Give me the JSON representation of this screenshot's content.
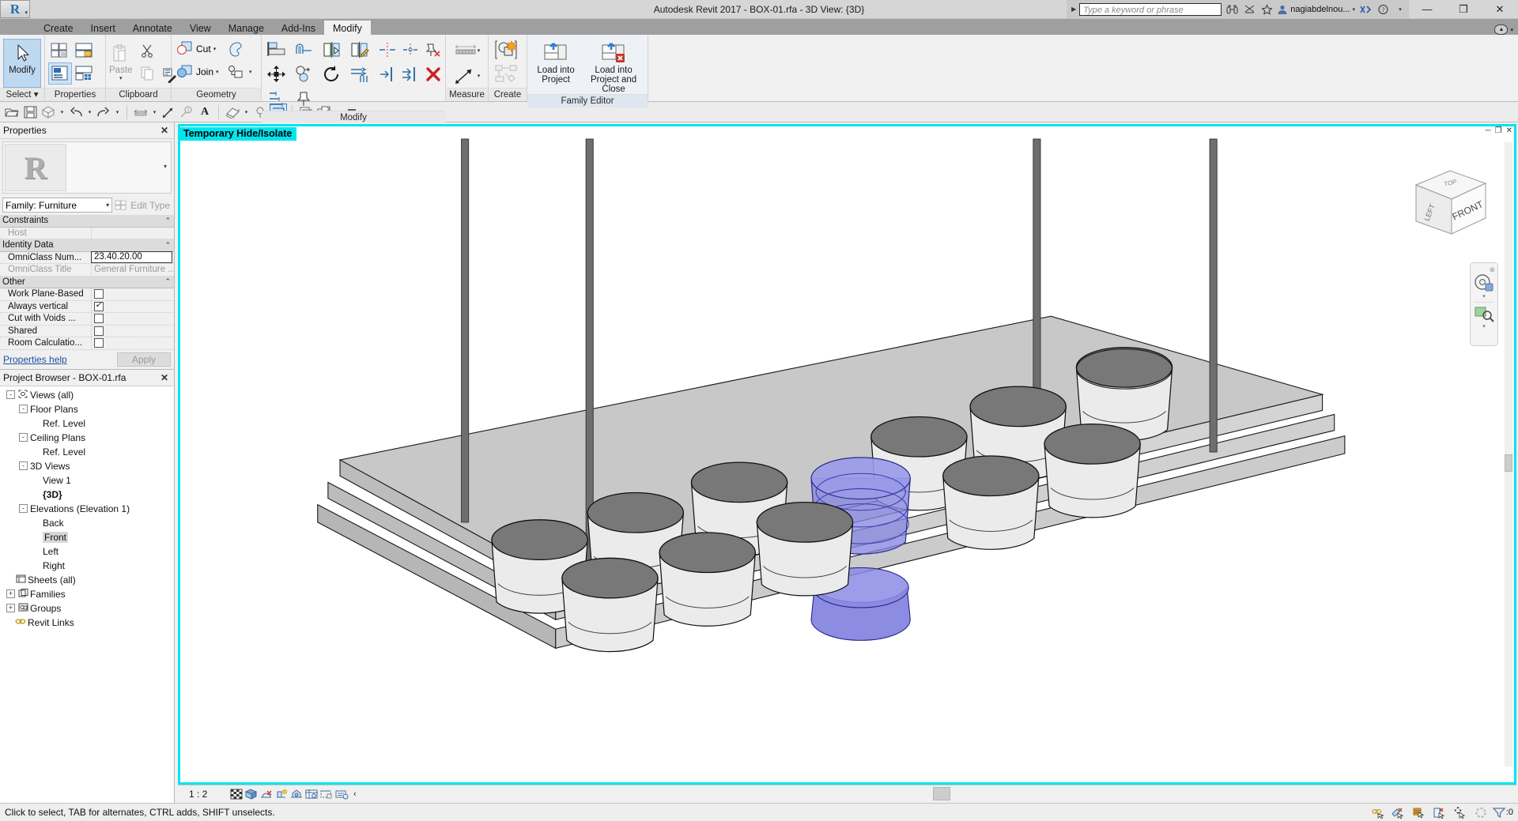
{
  "window": {
    "title": "Autodesk Revit 2017 -    BOX-01.rfa - 3D View: {3D}",
    "minimize": "—",
    "maximize": "❐",
    "close": "✕"
  },
  "titlebar": {
    "search_placeholder": "Type a keyword or phrase",
    "search_arrow": "▶",
    "user_name": "nagiabdelnou...",
    "user_caret": "▾",
    "help_caret": "▾",
    "icons": [
      "binoculars-icon",
      "subscription-icon",
      "favorites-star-icon",
      "user-avatar-icon",
      "exchange-app-icon",
      "help-icon"
    ]
  },
  "ribbon": {
    "tabs": [
      {
        "label": "Create",
        "active": false
      },
      {
        "label": "Insert",
        "active": false
      },
      {
        "label": "Annotate",
        "active": false
      },
      {
        "label": "View",
        "active": false
      },
      {
        "label": "Manage",
        "active": false
      },
      {
        "label": "Add-Ins",
        "active": false
      },
      {
        "label": "Modify",
        "active": true
      }
    ],
    "minimize_caret": "▾",
    "panels": [
      {
        "name": "Select",
        "label": "Select ▾",
        "buttons": [
          {
            "label": "Modify",
            "selected": true
          }
        ]
      },
      {
        "name": "Properties",
        "label": "Properties",
        "buttons": [
          {
            "label": "",
            "icon": "type-properties-icon"
          },
          {
            "label": "",
            "icon": "family-category-icon"
          },
          {
            "label": "",
            "icon": "family-types-icon",
            "selected": true
          },
          {
            "label": "",
            "icon": "family-parameters-icon"
          }
        ]
      },
      {
        "name": "Clipboard",
        "label": "Clipboard",
        "paste_label": "Paste",
        "paste_caret": "▾",
        "buttons": [
          {
            "label": "",
            "icon": "cut-icon"
          },
          {
            "label": "",
            "icon": "copy-icon"
          },
          {
            "label": "",
            "icon": "match-type-icon"
          }
        ]
      },
      {
        "name": "Geometry",
        "label": "Geometry",
        "buttons": [
          {
            "label": "Cut",
            "icon": "cut-geometry-icon",
            "caret": "▾"
          },
          {
            "label": "Join",
            "icon": "join-geometry-icon",
            "caret": "▾"
          },
          {
            "label": "",
            "icon": "paint-icon"
          },
          {
            "label": "",
            "icon": "split-face-icon",
            "caret": "▾"
          }
        ]
      },
      {
        "name": "Modify",
        "label": "Modify",
        "buttons": [
          {
            "label": "",
            "icon": "align-icon"
          },
          {
            "label": "",
            "icon": "offset-icon"
          },
          {
            "label": "",
            "icon": "mirror-pick-axis-icon"
          },
          {
            "label": "",
            "icon": "mirror-draw-axis-icon"
          },
          {
            "label": "",
            "icon": "split-element-icon"
          },
          {
            "label": "",
            "icon": "trim-extend-icon"
          },
          {
            "label": "",
            "icon": "unpin-icon"
          },
          {
            "label": "",
            "icon": "move-icon"
          },
          {
            "label": "",
            "icon": "copy-move-icon"
          },
          {
            "label": "",
            "icon": "rotate-icon"
          },
          {
            "label": "",
            "icon": "array-icon"
          },
          {
            "label": "",
            "icon": "scale-icon"
          },
          {
            "label": "",
            "icon": "pin-icon"
          },
          {
            "label": "",
            "icon": "trim-single-icon"
          },
          {
            "label": "",
            "icon": "trim-multiple-icon"
          },
          {
            "label": "",
            "icon": "delete-icon"
          }
        ]
      },
      {
        "name": "Measure",
        "label": "Measure",
        "buttons": [
          {
            "label": "",
            "icon": "measure-between-references-icon",
            "caret": "▾"
          },
          {
            "label": "",
            "icon": "measure-along-element-icon",
            "caret": "▾"
          }
        ]
      },
      {
        "name": "Create",
        "label": "Create",
        "buttons": [
          {
            "label": "",
            "icon": "create-similar-icon"
          },
          {
            "label": "",
            "icon": "create-group-icon"
          }
        ]
      },
      {
        "name": "Family Editor",
        "label": "Family Editor",
        "buttons": [
          {
            "label": "Load into\nProject",
            "line1": "Load into",
            "line2": "Project",
            "icon": "load-into-project-icon"
          },
          {
            "label": "Load into\nProject and Close",
            "line1": "Load into",
            "line2": "Project and Close",
            "icon": "load-into-project-and-close-icon"
          }
        ]
      }
    ]
  },
  "quick_access": {
    "items": [
      {
        "name": "open-icon",
        "caret": false
      },
      {
        "name": "save-icon",
        "caret": false
      },
      {
        "name": "3d-view-icon",
        "caret": true
      },
      {
        "name": "undo-icon",
        "caret": true
      },
      {
        "name": "redo-icon",
        "caret": true
      },
      {
        "name": "aligned-dimension-icon",
        "caret": true
      },
      {
        "name": "measure-icon",
        "caret": false
      },
      {
        "name": "tag-icon",
        "caret": false
      },
      {
        "name": "text-icon",
        "caret": false
      },
      {
        "name": "default-3d-view-icon",
        "caret": true
      },
      {
        "name": "section-icon",
        "caret": false
      },
      {
        "name": "thin-lines-icon",
        "caret": false,
        "selected": true
      },
      {
        "name": "close-hidden-windows-icon",
        "caret": false
      },
      {
        "name": "switch-windows-icon",
        "caret": true
      },
      {
        "name": "customize-qat-icon",
        "caret": false
      }
    ]
  },
  "properties_palette": {
    "title": "Properties",
    "close": "✕",
    "preview_glyph": "R",
    "preview_caret": "▾",
    "family_selector": "Family: Furniture",
    "family_caret": "▾",
    "edit_type": "Edit Type",
    "rows": [
      {
        "type": "group",
        "name": "Constraints",
        "chev": "⌃"
      },
      {
        "type": "row",
        "name": "Host",
        "value": "",
        "name_dim": true,
        "value_kind": "text"
      },
      {
        "type": "group",
        "name": "Identity Data",
        "chev": "⌃"
      },
      {
        "type": "row",
        "name": "OmniClass Num...",
        "value": "23.40.20.00",
        "value_kind": "boxed"
      },
      {
        "type": "row",
        "name": "OmniClass Title",
        "value": "General Furniture ...",
        "name_dim": true,
        "value_dim": true,
        "value_kind": "text"
      },
      {
        "type": "group",
        "name": "Other",
        "chev": "⌃"
      },
      {
        "type": "row",
        "name": "Work Plane-Based",
        "value_kind": "checkbox",
        "checked": false
      },
      {
        "type": "row",
        "name": "Always vertical",
        "value_kind": "checkbox",
        "checked": true
      },
      {
        "type": "row",
        "name": "Cut with Voids ...",
        "value_kind": "checkbox",
        "checked": false
      },
      {
        "type": "row",
        "name": "Shared",
        "value_kind": "checkbox",
        "checked": false
      },
      {
        "type": "row",
        "name": "Room Calculatio...",
        "value_kind": "checkbox",
        "checked": false
      }
    ],
    "help_link": "Properties help",
    "apply_button": "Apply"
  },
  "project_browser": {
    "title": "Project Browser - BOX-01.rfa",
    "close": "✕",
    "nodes": [
      {
        "label": "Views (all)",
        "depth": 0,
        "toggle": "-",
        "icon": "views-icon"
      },
      {
        "label": "Floor Plans",
        "depth": 1,
        "toggle": "-",
        "icon": ""
      },
      {
        "label": "Ref. Level",
        "depth": 2,
        "toggle": "",
        "icon": ""
      },
      {
        "label": "Ceiling Plans",
        "depth": 1,
        "toggle": "-",
        "icon": ""
      },
      {
        "label": "Ref. Level",
        "depth": 2,
        "toggle": "",
        "icon": ""
      },
      {
        "label": "3D Views",
        "depth": 1,
        "toggle": "-",
        "icon": ""
      },
      {
        "label": "View 1",
        "depth": 2,
        "toggle": "",
        "icon": ""
      },
      {
        "label": "{3D}",
        "depth": 2,
        "toggle": "",
        "icon": "",
        "bold": true
      },
      {
        "label": "Elevations (Elevation 1)",
        "depth": 1,
        "toggle": "-",
        "icon": ""
      },
      {
        "label": "Back",
        "depth": 2,
        "toggle": "",
        "icon": ""
      },
      {
        "label": "Front",
        "depth": 2,
        "toggle": "",
        "icon": "",
        "highlight": true
      },
      {
        "label": "Left",
        "depth": 2,
        "toggle": "",
        "icon": ""
      },
      {
        "label": "Right",
        "depth": 2,
        "toggle": "",
        "icon": ""
      },
      {
        "label": "Sheets (all)",
        "depth": 0,
        "toggle": "",
        "icon": "sheets-icon"
      },
      {
        "label": "Families",
        "depth": 0,
        "toggle": "+",
        "icon": "families-icon"
      },
      {
        "label": "Groups",
        "depth": 0,
        "toggle": "+",
        "icon": "groups-icon"
      },
      {
        "label": "Revit Links",
        "depth": 0,
        "toggle": "",
        "icon": "revit-links-icon"
      }
    ]
  },
  "view": {
    "hide_isolate_banner": "Temporary Hide/Isolate",
    "window_controls": {
      "minimize": "─",
      "restore": "❐",
      "close": "✕"
    },
    "viewcube": {
      "front": "FRONT",
      "left": "LEFT",
      "top": "TOP"
    },
    "nav_bar": {
      "close": "⊗",
      "steering_wheel": "steering-wheel-icon",
      "zoom": "zoom-icon",
      "caret": "▾"
    }
  },
  "view_control_bar": {
    "scale": "1 : 2",
    "icons": [
      "detail-level-icon",
      "visual-style-icon",
      "sun-path-icon",
      "shadows-icon",
      "render-icon",
      "crop-view-icon",
      "crop-region-visible-icon",
      "temporary-hide-isolate-icon"
    ],
    "more": "‹"
  },
  "status_bar": {
    "message": "Click to select, TAB for alternates, CTRL adds, SHIFT unselects.",
    "right_icons": [
      "editable-only-icon",
      "exclude-options-icon",
      "active-design-option-icon",
      "exclude-links-icon",
      "select-pinned-icon",
      "select-underlay-icon"
    ],
    "filter_label": ":0",
    "filter_icon": "filter-icon"
  },
  "colors": {
    "accent_cyan": "#00e5ef",
    "selection_blue": "#7b7bd8",
    "ribbon_bg": "#f1f1f1",
    "titlebar_bg": "#d6d6d6",
    "tabs_bg": "#9f9f9f",
    "model_light": "#ebebeb",
    "model_dark": "#787878",
    "model_base": "#c6c6c6",
    "rod_color": "#6e6e6e"
  }
}
